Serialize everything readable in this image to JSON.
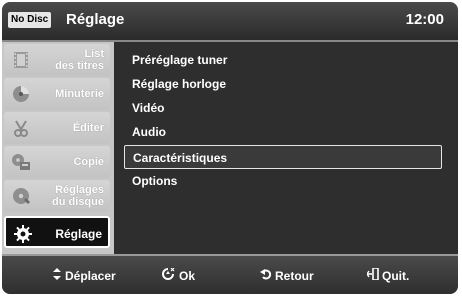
{
  "header": {
    "badge": "No Disc",
    "title": "Réglage",
    "time": "12:00"
  },
  "sidebar": {
    "items": [
      {
        "label_line1": "List",
        "label_line2": "des titres",
        "icon": "film-icon"
      },
      {
        "label_line1": "Minuterie",
        "label_line2": "",
        "icon": "timer-icon"
      },
      {
        "label_line1": "Éditer",
        "label_line2": "",
        "icon": "scissors-icon"
      },
      {
        "label_line1": "Copie",
        "label_line2": "",
        "icon": "copy-icon"
      },
      {
        "label_line1": "Réglages",
        "label_line2": "du disque",
        "icon": "disc-icon"
      },
      {
        "label_line1": "Réglage",
        "label_line2": "",
        "icon": "gear-icon",
        "active": true
      }
    ]
  },
  "menu": {
    "items": [
      "Préréglage tuner",
      "Réglage horloge",
      "Vidéo",
      "Audio",
      "Caractéristiques",
      "Options"
    ],
    "selected_index": 4
  },
  "footer": {
    "move": "Déplacer",
    "ok": "Ok",
    "back": "Retour",
    "quit": "Quit."
  },
  "colors": {
    "accent_white": "#ffffff",
    "panel_dark": "#2e2e2e",
    "sidebar_gray": "#c7c7c7"
  }
}
